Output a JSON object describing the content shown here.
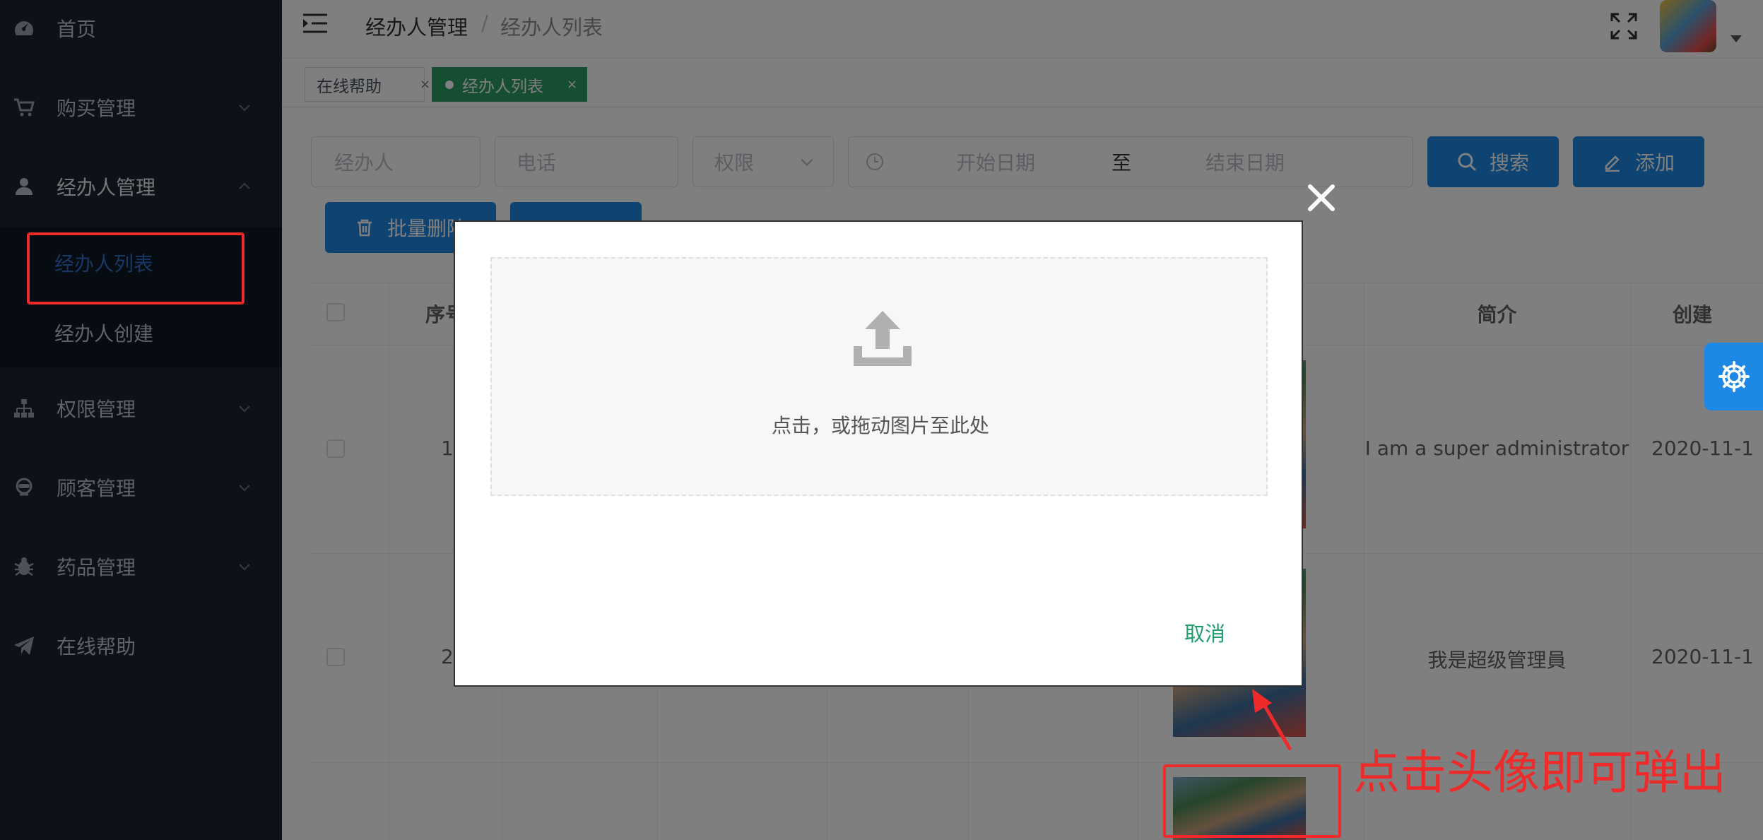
{
  "sidebar": {
    "items": [
      {
        "label": "首页",
        "icon": "dashboard-icon"
      },
      {
        "label": "购买管理",
        "icon": "cart-icon"
      },
      {
        "label": "经办人管理",
        "icon": "user-icon"
      },
      {
        "label": "权限管理",
        "icon": "sitemap-icon"
      },
      {
        "label": "顾客管理",
        "icon": "customer-icon"
      },
      {
        "label": "药品管理",
        "icon": "bug-icon"
      },
      {
        "label": "在线帮助",
        "icon": "paper-plane-icon"
      }
    ],
    "submenu": [
      {
        "label": "经办人列表",
        "active": true
      },
      {
        "label": "经办人创建",
        "active": false
      }
    ]
  },
  "header": {
    "breadcrumb_1": "经办人管理",
    "breadcrumb_sep": "/",
    "breadcrumb_2": "经办人列表"
  },
  "tags": {
    "help": "在线帮助",
    "active": "经办人列表",
    "close": "×"
  },
  "filters": {
    "agent_placeholder": "经办人",
    "phone_placeholder": "电话",
    "permission_placeholder": "权限",
    "start_date_placeholder": "开始日期",
    "range_sep": "至",
    "end_date_placeholder": "结束日期",
    "search_label": "搜索",
    "add_label": "添加",
    "batch_delete_label": "批量删除"
  },
  "table": {
    "headers": {
      "index": "序号",
      "intro": "简介",
      "created": "创建"
    },
    "rows": [
      {
        "index": "1",
        "intro": "I am a super administrator",
        "created": "2020-11-1"
      },
      {
        "index": "2",
        "intro": "我是超级管理員",
        "created": "2020-11-1"
      }
    ]
  },
  "modal": {
    "dropzone_text": "点击，或拖动图片至此处",
    "cancel_label": "取消"
  },
  "annotation": {
    "text": "点击头像即可弹出"
  },
  "colors": {
    "sidebar_bg": "#1b2433",
    "primary": "#1e88e5",
    "tag_active": "#2b9d62",
    "annotation": "#ee2a2a"
  }
}
